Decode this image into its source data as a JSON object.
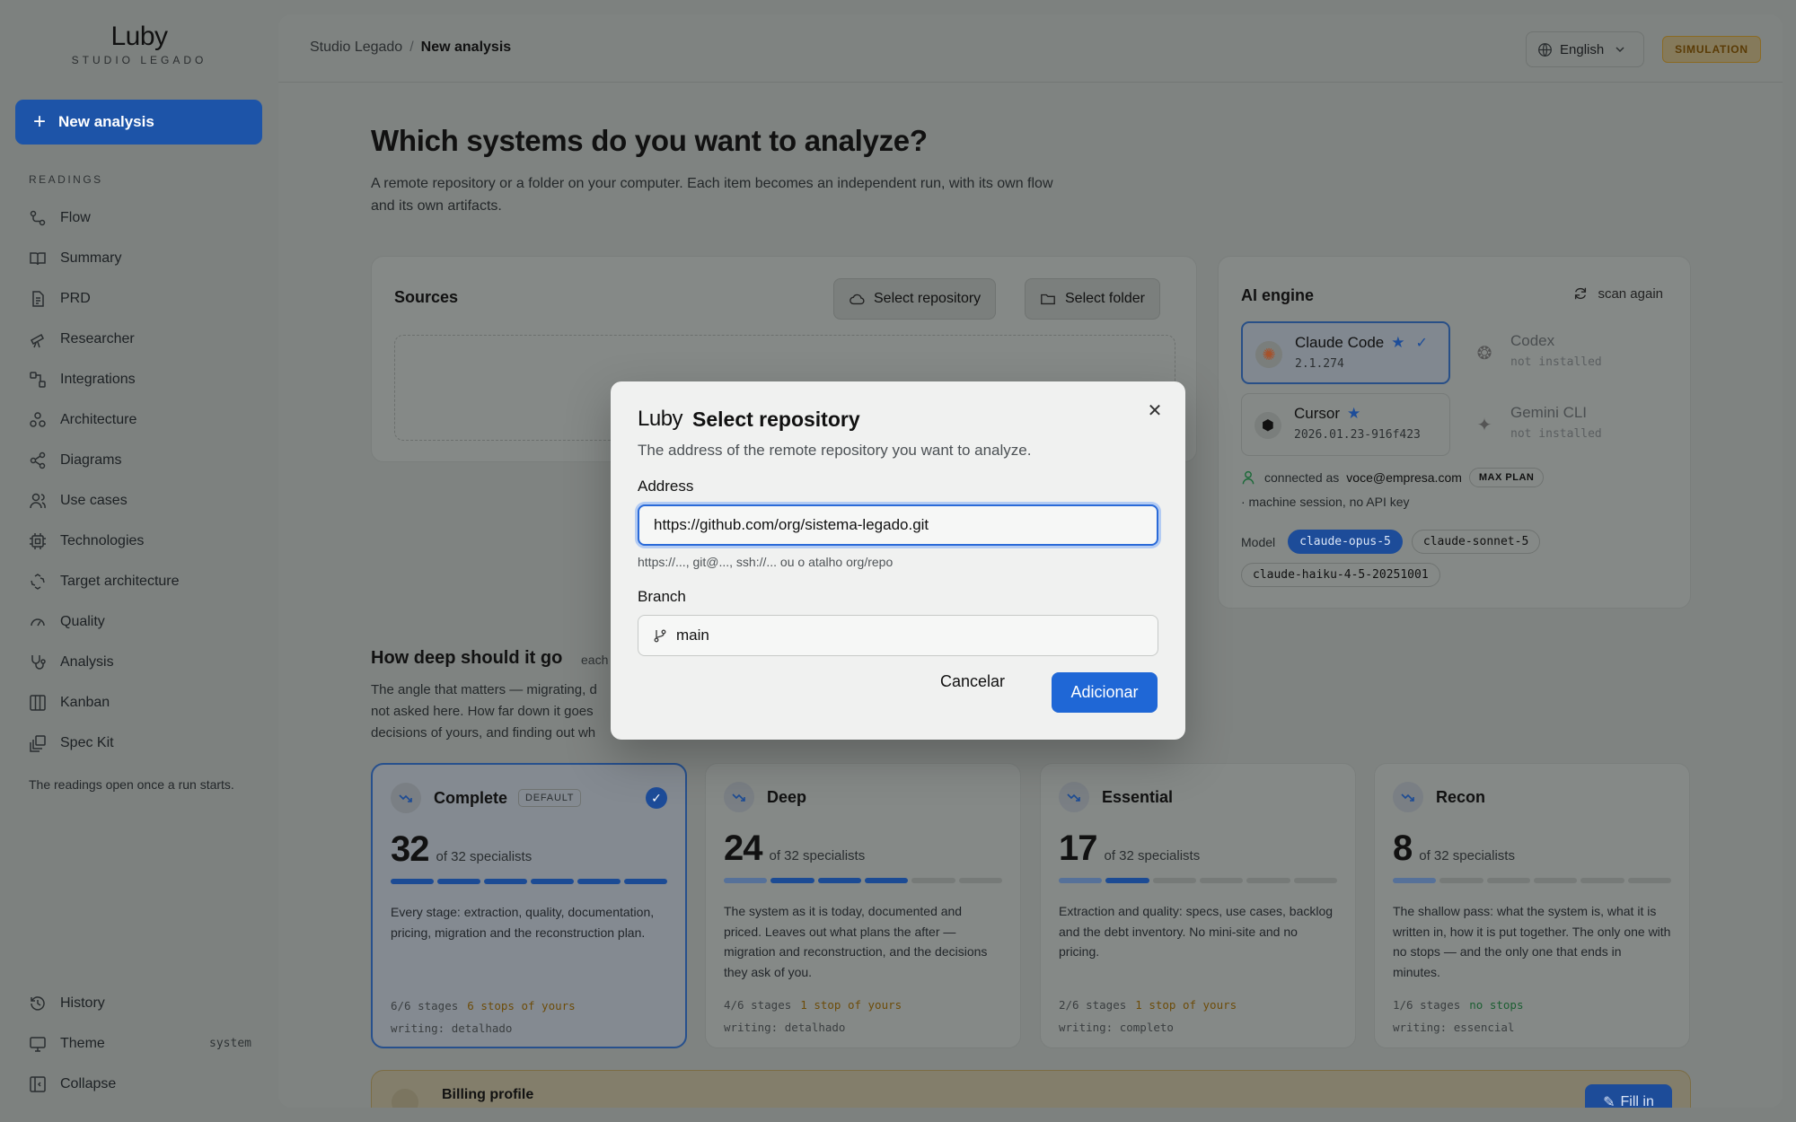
{
  "sidebar": {
    "logo": "Luby",
    "logo_sub": "STUDIO LEGADO",
    "new_analysis": "New analysis",
    "section": "READINGS",
    "items": [
      {
        "label": "Flow",
        "icon": "flow-icon"
      },
      {
        "label": "Summary",
        "icon": "book-icon"
      },
      {
        "label": "PRD",
        "icon": "document-icon"
      },
      {
        "label": "Researcher",
        "icon": "telescope-icon"
      },
      {
        "label": "Integrations",
        "icon": "integrations-icon"
      },
      {
        "label": "Architecture",
        "icon": "architecture-icon"
      },
      {
        "label": "Diagrams",
        "icon": "share-icon"
      },
      {
        "label": "Use cases",
        "icon": "users-icon"
      },
      {
        "label": "Technologies",
        "icon": "chip-icon"
      },
      {
        "label": "Target architecture",
        "icon": "recycle-icon"
      },
      {
        "label": "Quality",
        "icon": "gauge-icon"
      },
      {
        "label": "Analysis",
        "icon": "stethoscope-icon"
      },
      {
        "label": "Kanban",
        "icon": "kanban-icon"
      },
      {
        "label": "Spec Kit",
        "icon": "speckit-icon"
      }
    ],
    "note": "The readings open once a run starts.",
    "history": "History",
    "theme": "Theme",
    "theme_value": "system",
    "collapse": "Collapse"
  },
  "header": {
    "crumb_root": "Studio Legado",
    "crumb_sep": "/",
    "crumb_current": "New analysis",
    "language": "English",
    "mode_badge": "SIMULATION"
  },
  "page": {
    "title": "Which systems do you want to analyze?",
    "description": "A remote repository or a folder on your computer. Each item becomes an independent run, with its own flow and its own artifacts."
  },
  "sources": {
    "title": "Sources",
    "select_repo": "Select repository",
    "select_folder": "Select folder"
  },
  "ai": {
    "title": "AI engine",
    "scan": "scan again",
    "engines": [
      {
        "name": "Claude Code",
        "version": "2.1.274"
      },
      {
        "name": "Codex",
        "version": "not installed"
      },
      {
        "name": "Cursor",
        "version": "2026.01.23-916f423"
      },
      {
        "name": "Gemini CLI",
        "version": "not installed"
      }
    ],
    "connected_prefix": "connected as",
    "email": "voce@empresa.com",
    "plan": "MAX PLAN",
    "session": "· machine session, no API key",
    "model_label": "Model",
    "models": [
      "claude-opus-5",
      "claude-sonnet-5",
      "claude-haiku-4-5-20251001"
    ]
  },
  "depth": {
    "title": "How deep should it go",
    "note": "each",
    "desc_1": "The angle that matters — migrating, d",
    "desc_2": "not asked here. How far down it goes",
    "desc_3": "decisions of yours, and finding out wh",
    "of_label": "of 32 specialists",
    "tiers": [
      {
        "name": "Complete",
        "tag": "DEFAULT",
        "count": "32",
        "desc": "Every stage: extraction, quality, documentation, pricing, migration and the reconstruction plan.",
        "stages": "6/6 stages",
        "stops": "6 stops of yours",
        "writing": "writing: detalhado"
      },
      {
        "name": "Deep",
        "count": "24",
        "desc": "The system as it is today, documented and priced. Leaves out what plans the after — migration and reconstruction, and the decisions they ask of you.",
        "stages": "4/6 stages",
        "stops": "1 stop of yours",
        "writing": "writing: detalhado"
      },
      {
        "name": "Essential",
        "count": "17",
        "desc": "Extraction and quality: specs, use cases, backlog and the debt inventory. No mini-site and no pricing.",
        "stages": "2/6 stages",
        "stops": "1 stop of yours",
        "writing": "writing: completo"
      },
      {
        "name": "Recon",
        "count": "8",
        "desc": "The shallow pass: what the system is, what it is written in, how it is put together. The only one with no stops — and the only one that ends in minutes.",
        "stages": "1/6 stages",
        "stops": "no stops",
        "writing": "writing: essencial"
      }
    ]
  },
  "billing": {
    "title": "Billing profile",
    "fill": "Fill in"
  },
  "modal": {
    "logo": "Luby",
    "title": "Select repository",
    "subtitle": "The address of the remote repository you want to analyze.",
    "address_label": "Address",
    "address_value": "https://github.com/org/sistema-legado.git",
    "address_hint": "https://..., git@..., ssh://... ou o atalho org/repo",
    "branch_label": "Branch",
    "branch_value": "main",
    "cancel": "Cancelar",
    "add": "Adicionar"
  },
  "colors": {
    "accent": "#1f67d6",
    "overlay": "#7d817f",
    "modal_bg": "#f0f1f0"
  }
}
